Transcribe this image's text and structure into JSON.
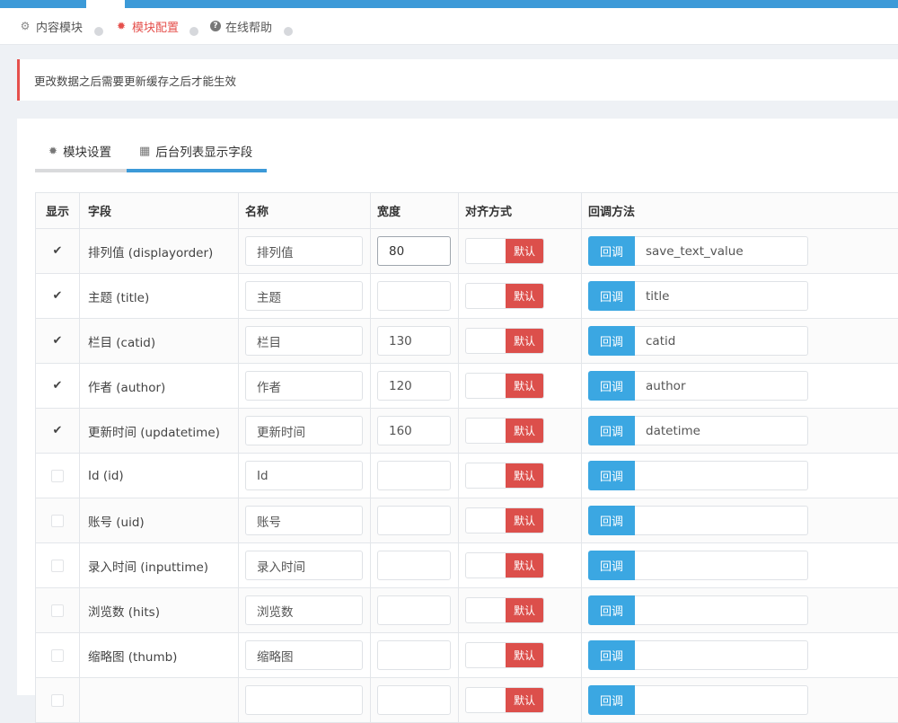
{
  "nav": {
    "items": [
      {
        "label": "内容模块",
        "icon": "gears-icon",
        "active": false
      },
      {
        "label": "模块配置",
        "icon": "gear-icon",
        "active": true
      },
      {
        "label": "在线帮助",
        "icon": "question-circle-icon",
        "active": false
      }
    ]
  },
  "alert": {
    "text": "更改数据之后需要更新缓存之后才能生效",
    "color": "#e5504c"
  },
  "tabs": [
    {
      "label": "模块设置",
      "icon": "gear-icon",
      "active": false
    },
    {
      "label": "后台列表显示字段",
      "icon": "table-icon",
      "active": true
    }
  ],
  "table": {
    "headers": [
      "显示",
      "字段",
      "名称",
      "宽度",
      "对齐方式",
      "回调方法"
    ],
    "toggle_label": "默认",
    "callback_label": "回调",
    "rows": [
      {
        "checked": true,
        "field": "排列值 (displayorder)",
        "name": "排列值",
        "width": "80",
        "callback": "save_text_value"
      },
      {
        "checked": true,
        "field": "主题 (title)",
        "name": "主题",
        "width": "",
        "callback": "title"
      },
      {
        "checked": true,
        "field": "栏目 (catid)",
        "name": "栏目",
        "width": "130",
        "callback": "catid"
      },
      {
        "checked": true,
        "field": "作者 (author)",
        "name": "作者",
        "width": "120",
        "callback": "author"
      },
      {
        "checked": true,
        "field": "更新时间 (updatetime)",
        "name": "更新时间",
        "width": "160",
        "callback": "datetime"
      },
      {
        "checked": false,
        "field": "Id (id)",
        "name": "Id",
        "width": "",
        "callback": ""
      },
      {
        "checked": false,
        "field": "账号 (uid)",
        "name": "账号",
        "width": "",
        "callback": ""
      },
      {
        "checked": false,
        "field": "录入时间 (inputtime)",
        "name": "录入时间",
        "width": "",
        "callback": ""
      },
      {
        "checked": false,
        "field": "浏览数 (hits)",
        "name": "浏览数",
        "width": "",
        "callback": ""
      },
      {
        "checked": false,
        "field": "缩略图 (thumb)",
        "name": "缩略图",
        "width": "",
        "callback": ""
      },
      {
        "checked": false,
        "field": "",
        "name": "",
        "width": "",
        "callback": ""
      }
    ]
  },
  "colors": {
    "accent": "#3c9ad8",
    "danger": "#dc4f4b",
    "callback": "#3ba7e2"
  }
}
